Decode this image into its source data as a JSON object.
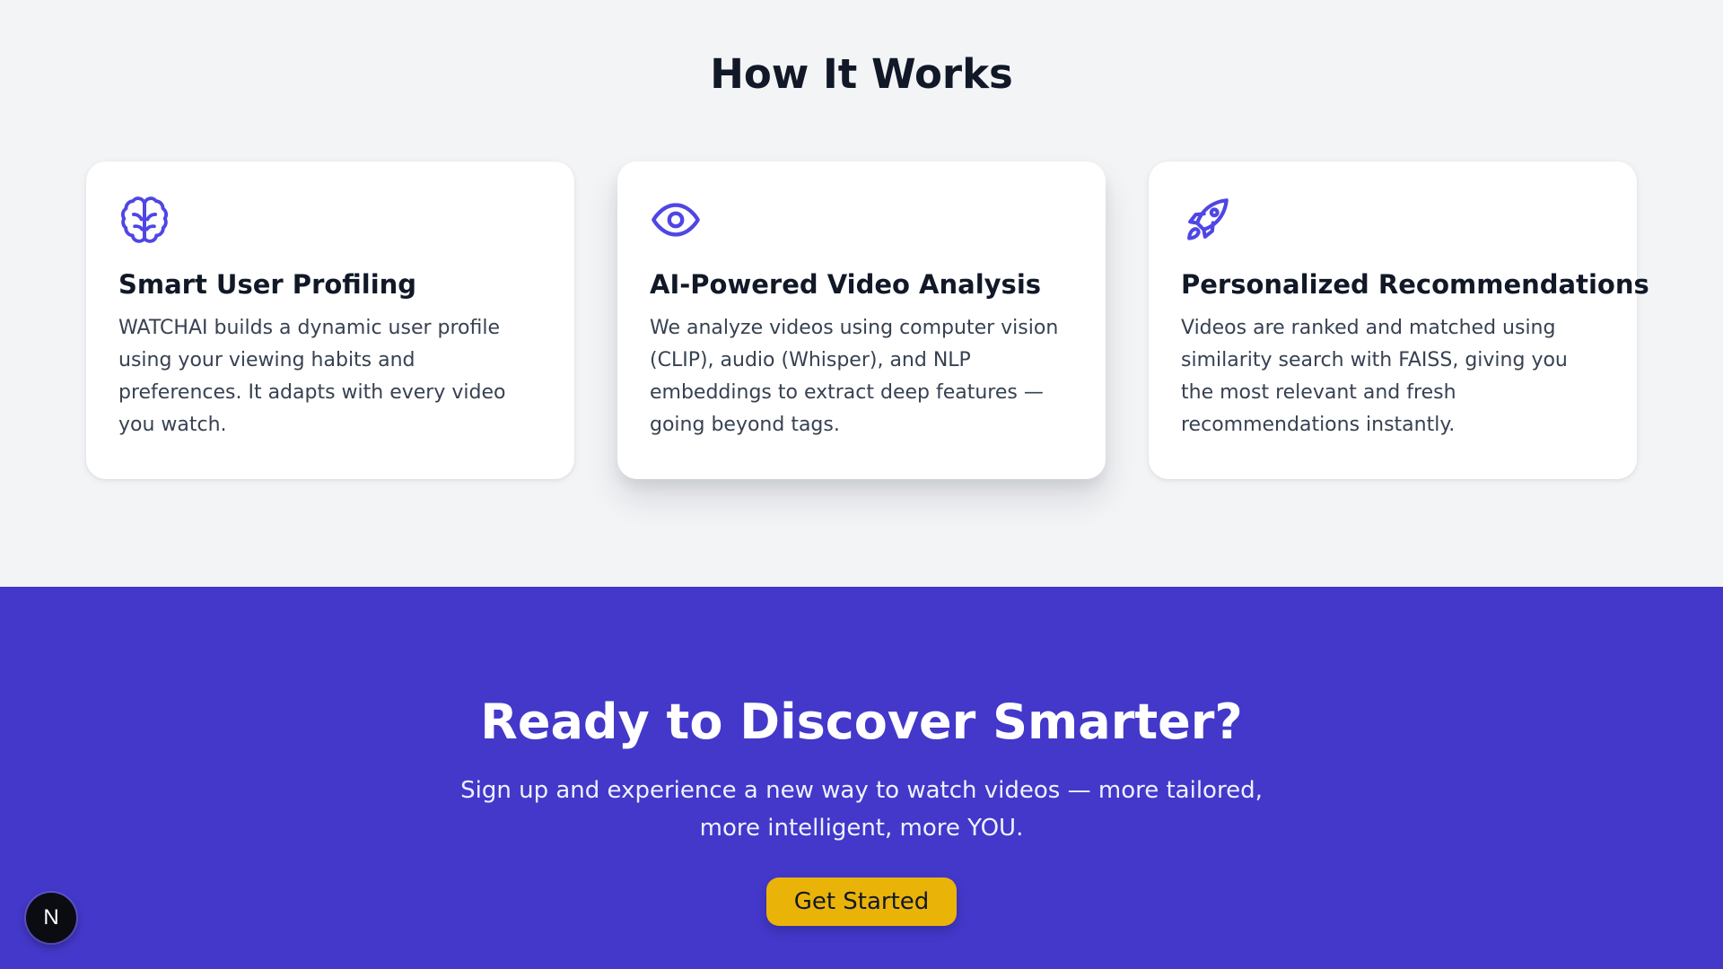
{
  "how_it_works": {
    "title": "How It Works",
    "cards": [
      {
        "icon": "brain-icon",
        "title": "Smart User Profiling",
        "body": "WATCHAI builds a dynamic user profile using your viewing habits and preferences. It adapts with every video you watch."
      },
      {
        "icon": "eye-icon",
        "title": "AI-Powered Video Analysis",
        "body": "We analyze videos using computer vision (CLIP), audio (Whisper), and NLP embeddings to extract deep features — going beyond tags."
      },
      {
        "icon": "rocket-icon",
        "title": "Personalized Recommendations",
        "body": "Videos are ranked and matched using similarity search with FAISS, giving you the most relevant and fresh recommendations instantly."
      }
    ]
  },
  "cta": {
    "title": "Ready to Discover Smarter?",
    "text": "Sign up and experience a new way to watch videos — more tailored, more intelligent, more YOU.",
    "button_label": "Get Started"
  },
  "dev_badge": {
    "label": "N"
  },
  "colors": {
    "page_background": "#f3f4f6",
    "accent": "#4f46e5",
    "cta_background": "#4338ca",
    "button": "#eab308",
    "heading": "#111827"
  }
}
